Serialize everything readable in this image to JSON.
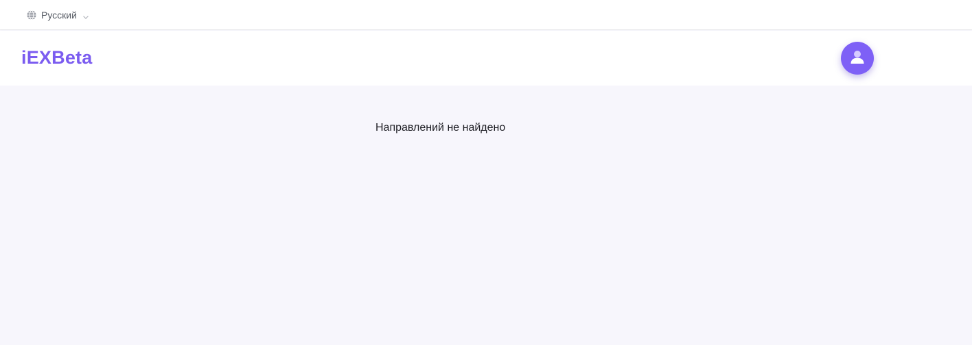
{
  "topbar": {
    "language": {
      "label": "Русский",
      "icon": "globe-icon",
      "dropdown_icon": "chevron-down-icon"
    }
  },
  "header": {
    "logo": "iEXBeta",
    "profile_icon": "user-icon",
    "colors": {
      "brand": "#7b5cf0",
      "avatar_bg": "#7e60f6"
    }
  },
  "main": {
    "empty_message": "Направлений не найдено"
  }
}
